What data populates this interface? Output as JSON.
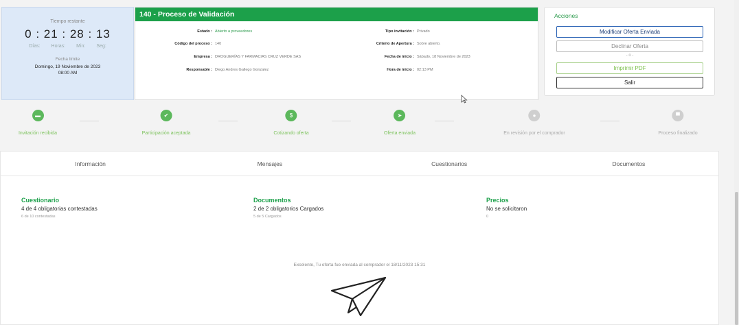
{
  "timer": {
    "label": "Tiempo restante",
    "countdown": "0 : 21 : 28 : 13",
    "units": [
      "Días:",
      "Horas:",
      "Min:",
      "Seg:"
    ],
    "deadline_label": "Fecha límite",
    "deadline_date": "Domingo, 19 Noviembre de 2023",
    "deadline_time": "08:00 AM"
  },
  "process": {
    "title": "140 - Proceso de Validación",
    "fields": {
      "estado_k": "Estado :",
      "estado_v": "Abierto a proveedores",
      "codigo_k": "Código del proceso :",
      "codigo_v": "140",
      "empresa_k": "Empresa :",
      "empresa_v": "DROGUERÍAS Y FARMACIAS CRUZ VERDE SAS",
      "responsable_k": "Responsable :",
      "responsable_v": "Diego Andres Gallego Gonzalez",
      "tipo_k": "Tipo invitación :",
      "tipo_v": "Privado",
      "criterio_k": "Criterio de Apertura :",
      "criterio_v": "Sobre abierto.",
      "fecha_k": "Fecha de inicio :",
      "fecha_v": "Sábado, 18 Noviembre de 2023",
      "hora_k": "Hora de inicio :",
      "hora_v": "02:13 PM"
    }
  },
  "actions": {
    "title": "Acciones",
    "modify": "Modificar Oferta Enviada",
    "decline": "Declinar Oferta",
    "separator": "- o -",
    "print": "Imprimir PDF",
    "exit": "Salir"
  },
  "steps": [
    {
      "label": "Invitación recibida",
      "glyph": "▬"
    },
    {
      "label": "Participación aceptada",
      "glyph": "✔"
    },
    {
      "label": "Cotizando oferta",
      "glyph": "$"
    },
    {
      "label": "Oferta enviada",
      "glyph": "➤"
    },
    {
      "label": "En revisión por el comprador",
      "glyph": "●"
    },
    {
      "label": "Proceso finalizado",
      "glyph": "▀"
    }
  ],
  "tabs": [
    "Información",
    "Mensajes",
    "Cuestionarios",
    "Documentos"
  ],
  "summary": {
    "questionnaire": {
      "title": "Cuestionario",
      "main": "4 de 4 obligatorias contestadas",
      "sub": "6 de 10 contestadas"
    },
    "documents": {
      "title": "Documentos",
      "main": "2 de 2 obligatorios Cargados",
      "sub": "5 de 5 Cargados"
    },
    "prices": {
      "title": "Precios",
      "main": "No se solicitaron",
      "sub": "0"
    }
  },
  "success_message": "Excelente, Tu oferta fue enviada al comprador el 18/11/2023 15:31",
  "colors": {
    "brand_green": "#1ca04a",
    "step_done": "#5cb85c",
    "step_pending": "#cfcfcf",
    "timer_bg": "#dde9f8"
  }
}
